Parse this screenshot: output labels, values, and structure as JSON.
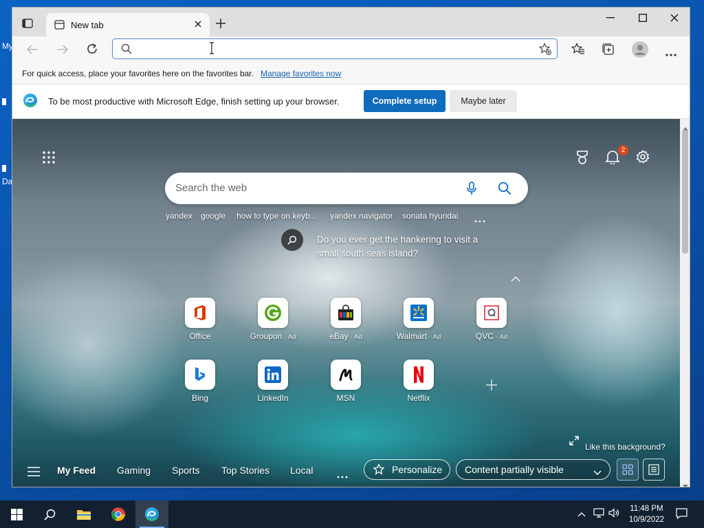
{
  "desktop": {
    "icon_labels": [
      "My",
      "Da"
    ]
  },
  "browser": {
    "tab": {
      "title": "New tab"
    },
    "address": {
      "value": "",
      "placeholder": ""
    },
    "favorites_bar": {
      "message": "For quick access, place your favorites here on the favorites bar.",
      "link": "Manage favorites now"
    },
    "infobar": {
      "message": "To be most productive with Microsoft Edge, finish setting up your browser.",
      "primary_button": "Complete setup",
      "secondary_button": "Maybe later"
    }
  },
  "newtab": {
    "notification_count": "2",
    "search": {
      "placeholder": "Search the web"
    },
    "quick_links": [
      "yandex",
      "google",
      "how to type on keyb...",
      "yandex navigator",
      "sonata hyundai"
    ],
    "background_prompt": {
      "line1": "Do you ever get the hankering to visit a",
      "line2": "small south seas island?"
    },
    "tiles": [
      {
        "label": "Office",
        "ad": ""
      },
      {
        "label": "Groupon",
        "ad": "· Ad"
      },
      {
        "label": "eBay",
        "ad": "· Ad"
      },
      {
        "label": "Walmart",
        "ad": "· Ad"
      },
      {
        "label": "QVC",
        "ad": "· Ad"
      },
      {
        "label": "Bing",
        "ad": ""
      },
      {
        "label": "LinkedIn",
        "ad": ""
      },
      {
        "label": "MSN",
        "ad": ""
      },
      {
        "label": "Netflix",
        "ad": ""
      }
    ],
    "like_background": "Like this background?",
    "feed": {
      "items": [
        "My Feed",
        "Gaming",
        "Sports",
        "Top Stories",
        "Local"
      ],
      "personalize": "Personalize",
      "content_visibility": "Content partially visible"
    }
  },
  "taskbar": {
    "time": "11:48 PM",
    "date": "10/9/2022"
  },
  "colors": {
    "accent": "#0f6cbd",
    "taskbar": "#13202f",
    "notification_badge": "#d9471f"
  }
}
